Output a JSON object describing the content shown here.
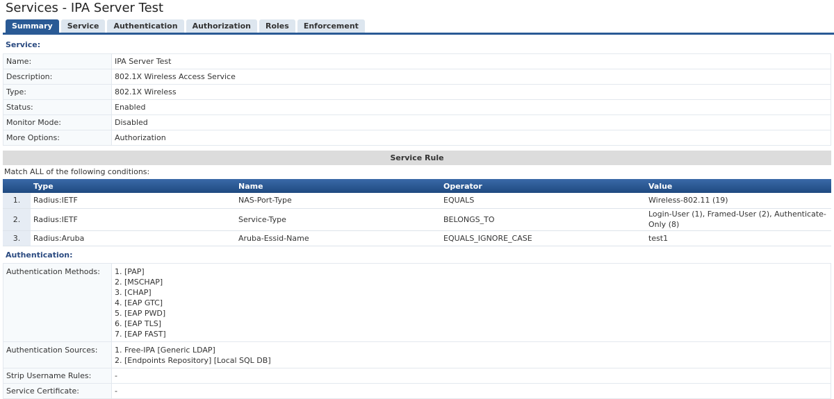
{
  "title": "Services - IPA Server Test",
  "tabs": [
    "Summary",
    "Service",
    "Authentication",
    "Authorization",
    "Roles",
    "Enforcement"
  ],
  "service": {
    "heading": "Service:",
    "rows": [
      {
        "k": "Name:",
        "v": "IPA Server Test"
      },
      {
        "k": "Description:",
        "v": "802.1X Wireless Access Service"
      },
      {
        "k": "Type:",
        "v": "802.1X Wireless"
      },
      {
        "k": "Status:",
        "v": "Enabled"
      },
      {
        "k": "Monitor Mode:",
        "v": "Disabled"
      },
      {
        "k": "More Options:",
        "v": "Authorization"
      }
    ]
  },
  "rule": {
    "title": "Service Rule",
    "match": "Match ALL of the following conditions:",
    "headers": [
      "Type",
      "Name",
      "Operator",
      "Value"
    ],
    "rows": [
      {
        "n": "1.",
        "type": "Radius:IETF",
        "name": "NAS-Port-Type",
        "op": "EQUALS",
        "value": "Wireless-802.11 (19)"
      },
      {
        "n": "2.",
        "type": "Radius:IETF",
        "name": "Service-Type",
        "op": "BELONGS_TO",
        "value": "Login-User (1), Framed-User (2), Authenticate-Only (8)"
      },
      {
        "n": "3.",
        "type": "Radius:Aruba",
        "name": "Aruba-Essid-Name",
        "op": "EQUALS_IGNORE_CASE",
        "value": "test1"
      }
    ]
  },
  "auth": {
    "heading": "Authentication:",
    "methods_label": "Authentication Methods:",
    "methods": [
      "1. [PAP]",
      "2. [MSCHAP]",
      "3. [CHAP]",
      "4. [EAP GTC]",
      "5. [EAP PWD]",
      "6. [EAP TLS]",
      "7. [EAP FAST]"
    ],
    "sources_label": "Authentication Sources:",
    "sources": [
      "1. Free-IPA [Generic LDAP]",
      "2. [Endpoints Repository] [Local SQL DB]"
    ],
    "strip_label": "Strip Username Rules:",
    "strip": "-",
    "cert_label": "Service Certificate:",
    "cert": "-"
  }
}
